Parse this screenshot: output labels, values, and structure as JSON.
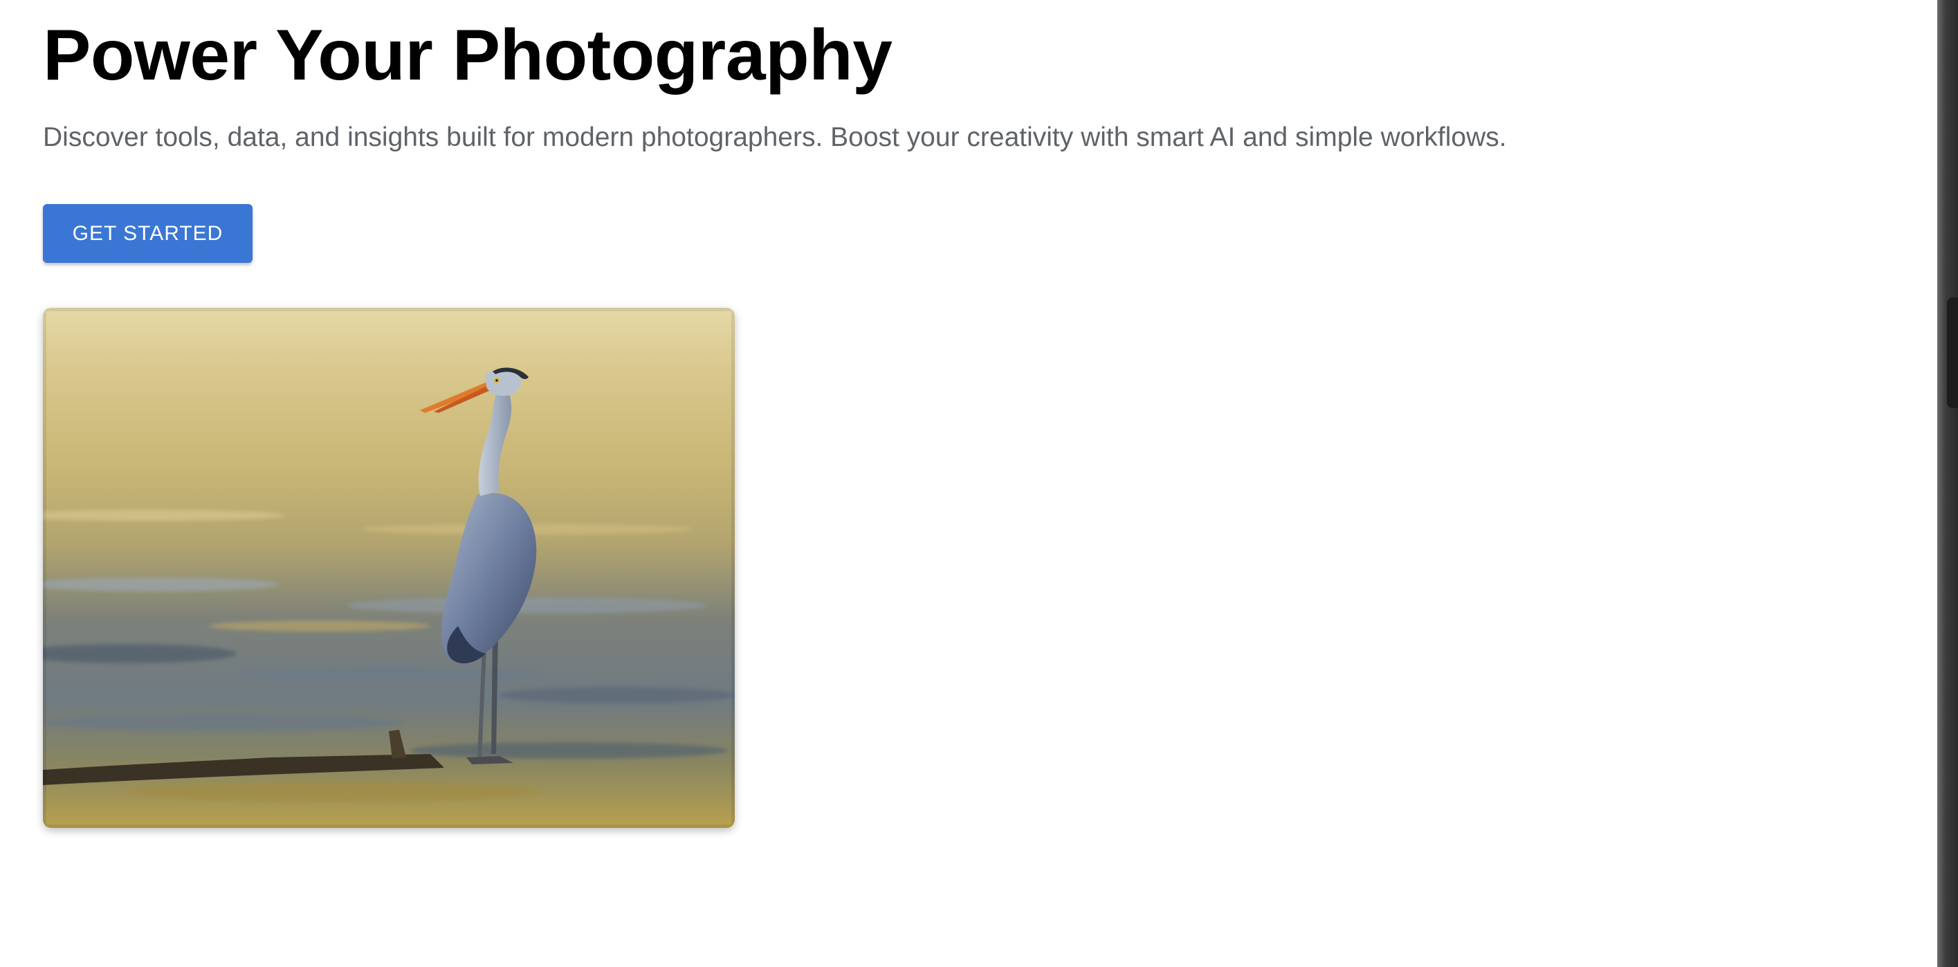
{
  "hero": {
    "title": "Power Your Photography",
    "subtitle": "Discover tools, data, and insights built for modern photographers. Boost your creativity with smart AI and simple workflows.",
    "cta_label": "GET STARTED"
  },
  "photo": {
    "subject": "heron-photo"
  },
  "colors": {
    "accent": "#3a76d4",
    "title": "#000000",
    "subtitle": "#5f6368",
    "background": "#ffffff"
  }
}
